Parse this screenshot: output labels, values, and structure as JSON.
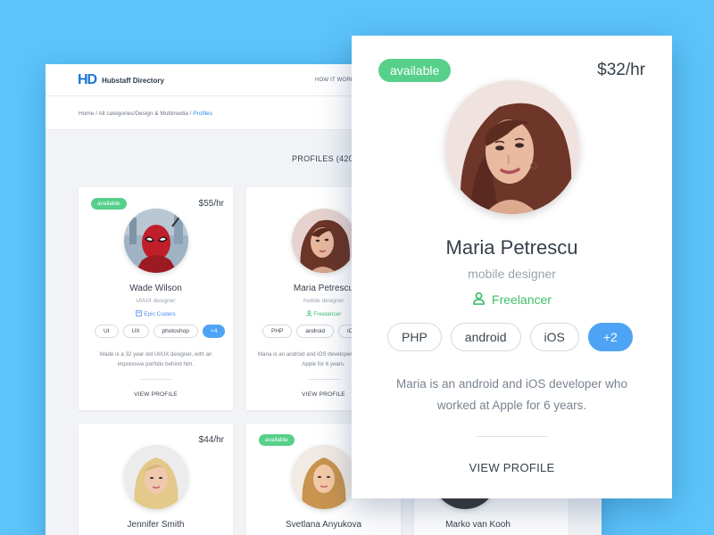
{
  "app": {
    "logo_mark": "HD",
    "name": "Hubstaff Directory",
    "nav_how_it_works": "HOW IT WORK",
    "breadcrumb_prefix": "Home / All categories/Design & Multimedia / ",
    "breadcrumb_active": "Profiles",
    "profiles_count": "PROFILES (420"
  },
  "cards": [
    {
      "available": "available",
      "price": "$55/hr",
      "name": "Wade Wilson",
      "role": "UI/UX designer",
      "meta": "Epic Coders",
      "tags": [
        "UI",
        "UX",
        "photoshop",
        "+4"
      ],
      "description": "Wade is a 32 year old UI/UX designer, with an impressive porfolio behind him.",
      "view": "VIEW PROFILE"
    },
    {
      "price": "",
      "name": "Maria Petrescu",
      "role": "mobile designer",
      "meta": "Freelancer",
      "tags": [
        "PHP",
        "android",
        "iOS"
      ],
      "description": "Maria is an android and iOS developer who worked at Apple for 6 years.",
      "view": "VIEW PROFILE"
    },
    {
      "price": "$44/hr",
      "name": "Jennifer Smith"
    },
    {
      "available": "available",
      "name": "Svetlana Anyukova"
    },
    {
      "name": "Marko van Kooh"
    }
  ],
  "detail": {
    "available": "available",
    "price": "$32/hr",
    "name": "Maria Petrescu",
    "role": "mobile designer",
    "meta": "Freelancer",
    "tags": [
      "PHP",
      "android",
      "iOS",
      "+2"
    ],
    "description": "Maria is an android and iOS developer who worked at Apple for 6 years.",
    "view": "VIEW PROFILE"
  },
  "colors": {
    "background": "#5cc4fb",
    "available": "#56d08b",
    "accent": "#4ea3f4",
    "freelancer": "#3fbf6a"
  }
}
